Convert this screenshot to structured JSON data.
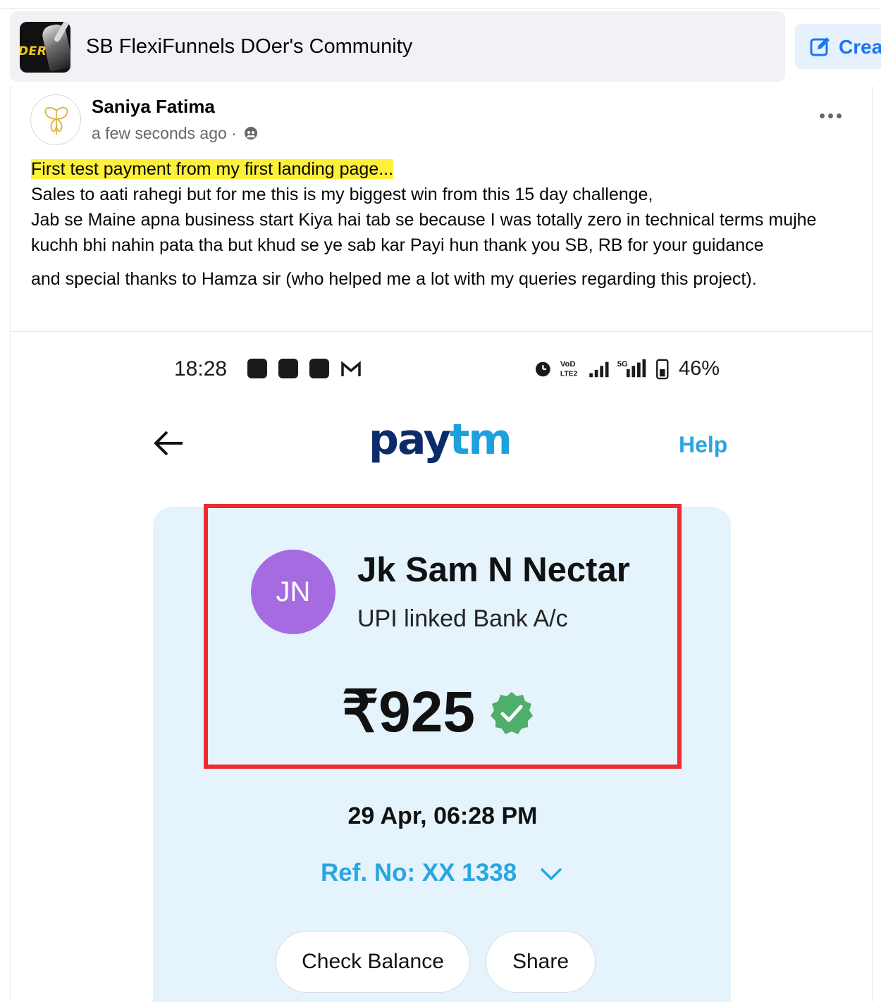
{
  "group": {
    "logo_text": "DER",
    "name": "SB FlexiFunnels DOer's Community",
    "create_label": "Crea"
  },
  "post": {
    "author": "Saniya Fatima",
    "timestamp": "a few seconds ago",
    "separator": "·",
    "text": {
      "highlight": "First test payment from my first landing page...",
      "line1": "Sales to aati rahegi but for me this is my biggest win from this 15 day challenge,",
      "line2": "Jab se Maine apna business start Kiya hai tab se because I was totally zero in technical terms mujhe kuchh bhi nahin pata tha but khud se ye sab kar Payi hun thank you SB, RB for your guidance",
      "line3": "and special thanks to Hamza sir (who helped me a lot with my queries regarding this project)."
    }
  },
  "screenshot": {
    "status_bar": {
      "time": "18:28",
      "battery": "46%",
      "network_label": "5G",
      "volte_label": "VoD LTE2"
    },
    "header": {
      "logo_pay": "pay",
      "logo_tm": "tm",
      "help": "Help"
    },
    "receipt": {
      "initials": "JN",
      "payee": "Jk Sam N Nectar",
      "account": "UPI linked Bank A/c",
      "amount": "₹925",
      "datetime": "29 Apr, 06:28 PM",
      "ref": "Ref. No: XX 1338",
      "check_balance": "Check Balance",
      "share": "Share"
    },
    "colors": {
      "highlight_box": "#ee2a33",
      "card_bg": "#e4f3fc",
      "avatar_bg": "#a66be0",
      "verified": "#4fae6a",
      "accent": "#2aa5e0"
    }
  }
}
